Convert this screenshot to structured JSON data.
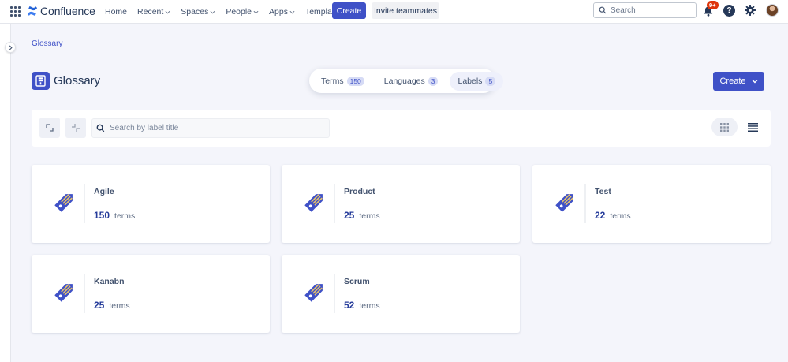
{
  "nav": {
    "brand": "Confluence",
    "items": [
      {
        "label": "Home",
        "has_menu": false
      },
      {
        "label": "Recent",
        "has_menu": true
      },
      {
        "label": "Spaces",
        "has_menu": true
      },
      {
        "label": "People",
        "has_menu": true
      },
      {
        "label": "Apps",
        "has_menu": true
      },
      {
        "label": "Templates",
        "has_menu": false
      }
    ],
    "create_label": "Create",
    "invite_label": "Invite teammates",
    "search_placeholder": "Search",
    "notification_badge": "9+",
    "help_label": "?"
  },
  "breadcrumb": "Glossary",
  "page_title": "Glossary",
  "tabs": [
    {
      "label": "Terms",
      "count": "150",
      "active": false
    },
    {
      "label": "Languages",
      "count": "3",
      "active": false
    },
    {
      "label": "Labels",
      "count": "5",
      "active": true
    }
  ],
  "create_button": "Create",
  "toolbar": {
    "search_placeholder": "Search by label title",
    "view_mode": "grid"
  },
  "cards": [
    {
      "name": "Agile",
      "count": "150",
      "unit": "terms"
    },
    {
      "name": "Product",
      "count": "25",
      "unit": "terms"
    },
    {
      "name": "Test",
      "count": "22",
      "unit": "terms"
    },
    {
      "name": "Kanabn",
      "count": "25",
      "unit": "terms"
    },
    {
      "name": "Scrum",
      "count": "52",
      "unit": "terms"
    }
  ],
  "colors": {
    "accent": "#3f51c7",
    "tag_fill": "#3f51c7",
    "tag_stripes": "#e8c36a",
    "background": "#f4f5fb"
  }
}
